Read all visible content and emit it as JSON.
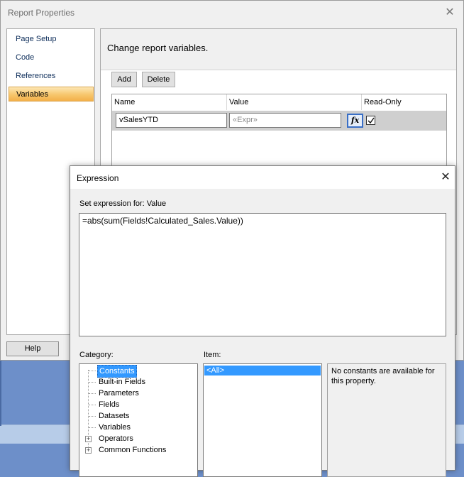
{
  "report_properties": {
    "title": "Report Properties",
    "close_glyph": "✕",
    "nav": [
      "Page Setup",
      "Code",
      "References",
      "Variables"
    ],
    "selected_nav": "Variables",
    "heading": "Change report variables.",
    "add_label": "Add",
    "delete_label": "Delete",
    "help_label": "Help",
    "columns": [
      "Name",
      "Value",
      "Read-Only"
    ],
    "variable": {
      "name": "vSalesYTD",
      "value_placeholder": "«Expr»",
      "fx_label": "fx",
      "read_only": true
    }
  },
  "expression": {
    "title": "Expression",
    "close_glyph": "✕",
    "set_label": "Set expression for: Value",
    "value": "=abs(sum(Fields!Calculated_Sales.Value))",
    "category_label": "Category:",
    "item_label": "Item:",
    "categories": [
      "Constants",
      "Built-in Fields",
      "Parameters",
      "Fields",
      "Datasets",
      "Variables",
      "Operators",
      "Common Functions"
    ],
    "selected_category": "Constants",
    "items": [
      "<All>"
    ],
    "description": "No constants are available for this property."
  },
  "colors": {
    "selection_blue": "#3399ff",
    "nav_selected": "#f7c66c",
    "desktop": "#6d8fc9"
  }
}
